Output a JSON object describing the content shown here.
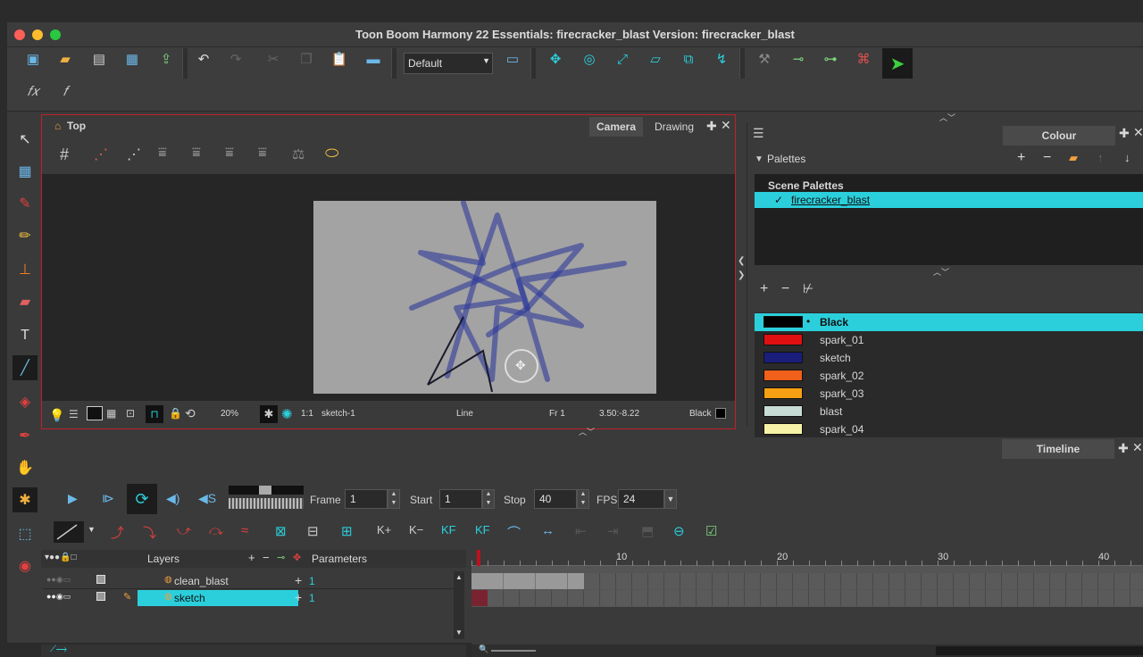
{
  "window": {
    "title": "Toon Boom Harmony 22 Essentials: firecracker_blast Version: firecracker_blast"
  },
  "toolbar": {
    "workspace_select": "Default"
  },
  "view": {
    "breadcrumb": "Top",
    "tabs": [
      "Camera",
      "Drawing"
    ],
    "status": {
      "zoom": "20%",
      "ratio": "1:1",
      "drawing": "sketch-1",
      "tool": "Line",
      "frame": "Fr 1",
      "coords": "3.50:-8.22",
      "colour": "Black"
    }
  },
  "colour": {
    "tab": "Colour",
    "palettes_label": "Palettes",
    "scene_palettes_label": "Scene Palettes",
    "palette_name": "firecracker_blast",
    "swatches": [
      {
        "name": "Black",
        "color": "#000000"
      },
      {
        "name": "spark_01",
        "color": "#e01010"
      },
      {
        "name": "sketch",
        "color": "#1a1e7a"
      },
      {
        "name": "spark_02",
        "color": "#f0601a"
      },
      {
        "name": "spark_03",
        "color": "#f5a012"
      },
      {
        "name": "blast",
        "color": "#c8dcd6"
      },
      {
        "name": "spark_04",
        "color": "#f6f3a6"
      }
    ]
  },
  "timeline": {
    "tab": "Timeline",
    "frame_label": "Frame",
    "frame_value": "1",
    "start_label": "Start",
    "start_value": "1",
    "stop_label": "Stop",
    "stop_value": "40",
    "fps_label": "FPS",
    "fps_value": "24",
    "layers_header": "Layers",
    "parameters_header": "Parameters",
    "layers": [
      {
        "name": "clean_blast",
        "param": "1"
      },
      {
        "name": "sketch",
        "param": "1"
      }
    ],
    "ruler_marks": [
      "10",
      "20",
      "30",
      "40"
    ]
  },
  "accent": "#2bcfdc"
}
